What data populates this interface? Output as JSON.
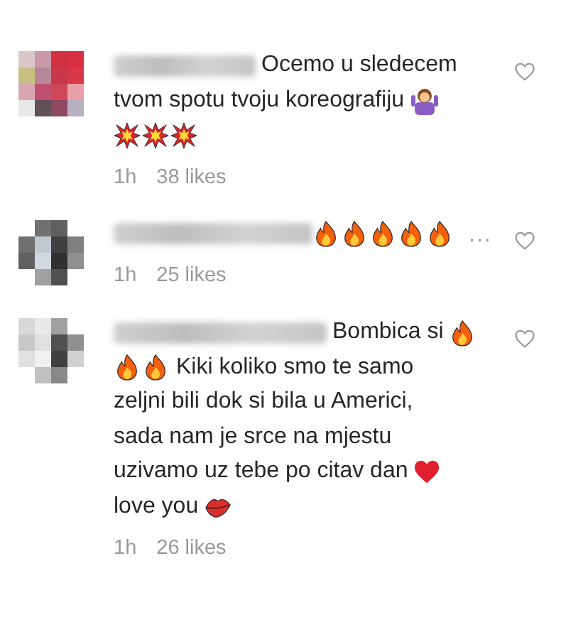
{
  "comments": [
    {
      "lines": [
        [
          {
            "kind": "text",
            "text": "Ocemo u sledecem"
          }
        ],
        [
          {
            "kind": "text",
            "text": "tvom spotu tvoju koreografiju"
          },
          {
            "kind": "shrug"
          }
        ],
        [
          {
            "kind": "explosion"
          },
          {
            "kind": "explosion"
          },
          {
            "kind": "explosion"
          }
        ]
      ],
      "time": "1h",
      "likes": "38 likes",
      "liked": false
    },
    {
      "lines": [
        [
          {
            "kind": "fire"
          },
          {
            "kind": "fire"
          },
          {
            "kind": "fire"
          },
          {
            "kind": "fire"
          },
          {
            "kind": "fire"
          }
        ]
      ],
      "time": "1h",
      "likes": "25 likes",
      "more_label": "...",
      "liked": false
    },
    {
      "lines": [
        [
          {
            "kind": "text",
            "text": "Bombica si"
          },
          {
            "kind": "fire"
          }
        ],
        [
          {
            "kind": "fire"
          },
          {
            "kind": "fire"
          },
          {
            "kind": "text",
            "text": "Kiki koliko smo te samo"
          }
        ],
        [
          {
            "kind": "text",
            "text": "zeljni bili dok si bila u Americi,"
          }
        ],
        [
          {
            "kind": "text",
            "text": "sada nam je srce na mjestu"
          }
        ],
        [
          {
            "kind": "text",
            "text": "uzivamo uz tebe po citav dan"
          },
          {
            "kind": "heart"
          }
        ],
        [
          {
            "kind": "text",
            "text": "love you"
          },
          {
            "kind": "lips"
          }
        ]
      ],
      "time": "1h",
      "likes": "26 likes",
      "liked": false
    }
  ]
}
